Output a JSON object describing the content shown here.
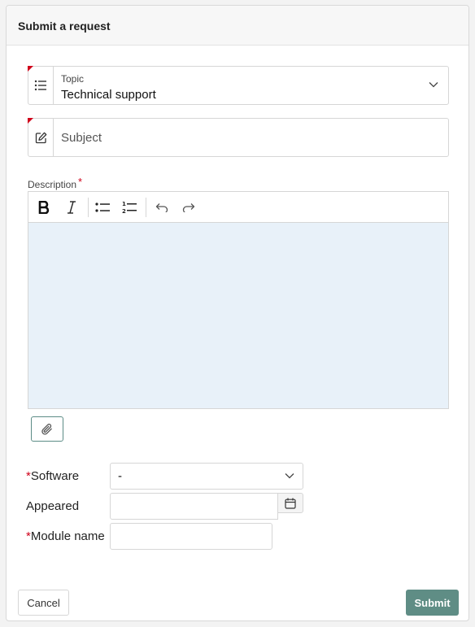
{
  "header": {
    "title": "Submit a request"
  },
  "topic": {
    "label": "Topic",
    "value": "Technical support",
    "icon": "list-icon",
    "required": true
  },
  "subject": {
    "placeholder": "Subject",
    "value": "",
    "icon": "edit-icon",
    "required": true
  },
  "description": {
    "label": "Description",
    "required_mark": "*",
    "toolbar": [
      "bold-icon",
      "italic-icon",
      "bullet-list-icon",
      "numbered-list-icon",
      "undo-icon",
      "redo-icon"
    ],
    "value": ""
  },
  "attachment": {
    "icon": "paperclip-icon"
  },
  "fields": {
    "required_mark": "*",
    "software": {
      "label": "Software",
      "value": "-",
      "required": true
    },
    "appeared": {
      "label": "Appeared",
      "value": "",
      "icon": "calendar-icon"
    },
    "module_name": {
      "label": "Module name",
      "value": "",
      "required": true
    }
  },
  "footer": {
    "cancel_label": "Cancel",
    "submit_label": "Submit"
  },
  "colors": {
    "accent": "#5f8d85",
    "required": "#d0021b",
    "editor_bg": "#e8f1f9"
  }
}
